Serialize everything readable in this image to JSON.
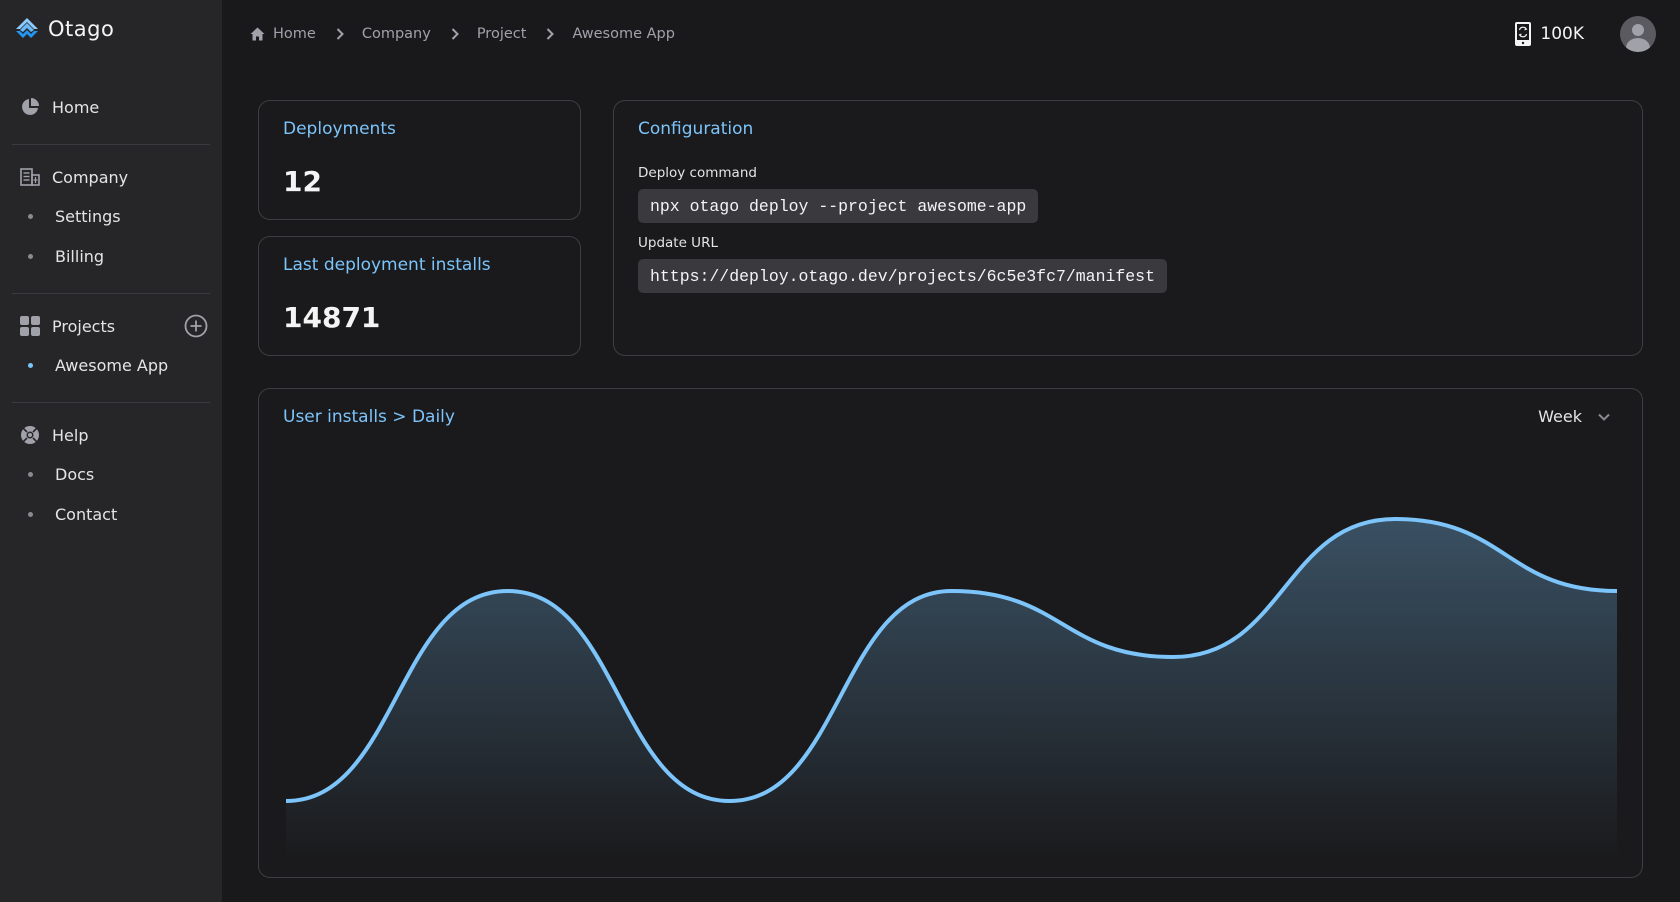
{
  "app": {
    "name": "Otago"
  },
  "sidebar": {
    "home": {
      "label": "Home",
      "icon": "pie-chart-icon"
    },
    "company": {
      "label": "Company",
      "icon": "building-icon",
      "items": [
        {
          "label": "Settings"
        },
        {
          "label": "Billing"
        }
      ]
    },
    "projects": {
      "label": "Projects",
      "icon": "grid-icon",
      "add_icon": "plus-circle-icon",
      "items": [
        {
          "label": "Awesome App",
          "active": true
        }
      ]
    },
    "help": {
      "label": "Help",
      "icon": "lifebuoy-icon",
      "items": [
        {
          "label": "Docs"
        },
        {
          "label": "Contact"
        }
      ]
    }
  },
  "header": {
    "breadcrumb": [
      {
        "label": "Home",
        "icon": "home-icon"
      },
      {
        "label": "Company"
      },
      {
        "label": "Project"
      },
      {
        "label": "Awesome App"
      }
    ],
    "credits": {
      "value": "100K",
      "icon": "phone-sync-icon"
    },
    "avatar_icon": "user-avatar-icon"
  },
  "cards": {
    "deployments": {
      "title": "Deployments",
      "value": "12"
    },
    "last_installs": {
      "title": "Last deployment installs",
      "value": "14871"
    },
    "configuration": {
      "title": "Configuration",
      "deploy_label": "Deploy command",
      "deploy_command": "npx otago deploy --project awesome-app",
      "update_label": "Update URL",
      "update_url": "https://deploy.otago.dev/projects/6c5e3fc7/manifest"
    }
  },
  "colors": {
    "accent": "#7cc4fa",
    "sidebar_bg": "#262628",
    "page_bg": "#19191b",
    "card_border": "#3e3e42"
  },
  "chart_data": {
    "type": "area",
    "title": "User installs > Daily",
    "period_select": {
      "selected": "Week",
      "icon": "chevron-down-icon"
    },
    "x": [
      1,
      2,
      3,
      4,
      5,
      6,
      7
    ],
    "values": [
      500,
      4000,
      500,
      4000,
      2900,
      5200,
      4000
    ],
    "xlabel": "",
    "ylabel": "",
    "ylim": [
      0,
      6000
    ],
    "grid": false,
    "axes_visible": false,
    "curve": "smooth",
    "line_color": "#7cc4fa"
  }
}
